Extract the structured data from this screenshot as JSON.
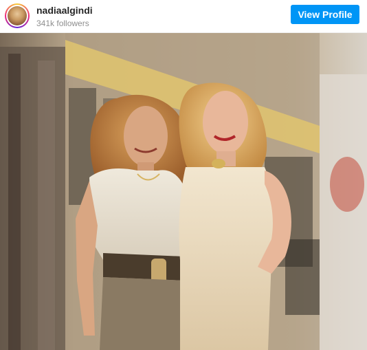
{
  "header": {
    "username": "nadiaalgindi",
    "followers": "341k followers",
    "view_profile_label": "View Profile"
  },
  "post": {
    "image_subject": "two-women-posing-photo"
  },
  "colors": {
    "button_bg": "#0095f6",
    "button_text": "#ffffff",
    "username_text": "#262626",
    "muted_text": "#8e8e8e"
  }
}
